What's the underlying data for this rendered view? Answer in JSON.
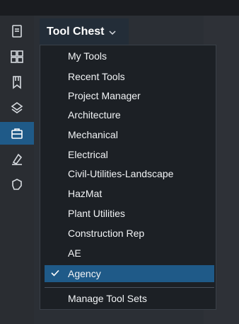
{
  "header": {
    "title": "Tool Chest"
  },
  "dropdown": {
    "items": [
      {
        "label": "My Tools"
      },
      {
        "label": "Recent Tools"
      },
      {
        "label": "Project Manager"
      },
      {
        "label": "Architecture"
      },
      {
        "label": "Mechanical"
      },
      {
        "label": "Electrical"
      },
      {
        "label": "Civil-Utilities-Landscape"
      },
      {
        "label": "HazMat"
      },
      {
        "label": "Plant Utilities"
      },
      {
        "label": "Construction Rep"
      },
      {
        "label": "AE"
      },
      {
        "label": "Agency",
        "selected": true
      }
    ],
    "manage_label": "Manage Tool Sets"
  },
  "sidebar": {
    "icons": [
      {
        "name": "document-icon"
      },
      {
        "name": "grid-icon"
      },
      {
        "name": "bookmark-icon"
      },
      {
        "name": "layers-icon"
      },
      {
        "name": "toolbox-icon",
        "active": true
      },
      {
        "name": "markup-icon"
      },
      {
        "name": "shape-icon"
      }
    ]
  },
  "colors": {
    "accent": "#1f5a88",
    "menu_bg": "#1c2025",
    "rail_bg": "#2a2d32",
    "text": "#f2f4f6"
  }
}
